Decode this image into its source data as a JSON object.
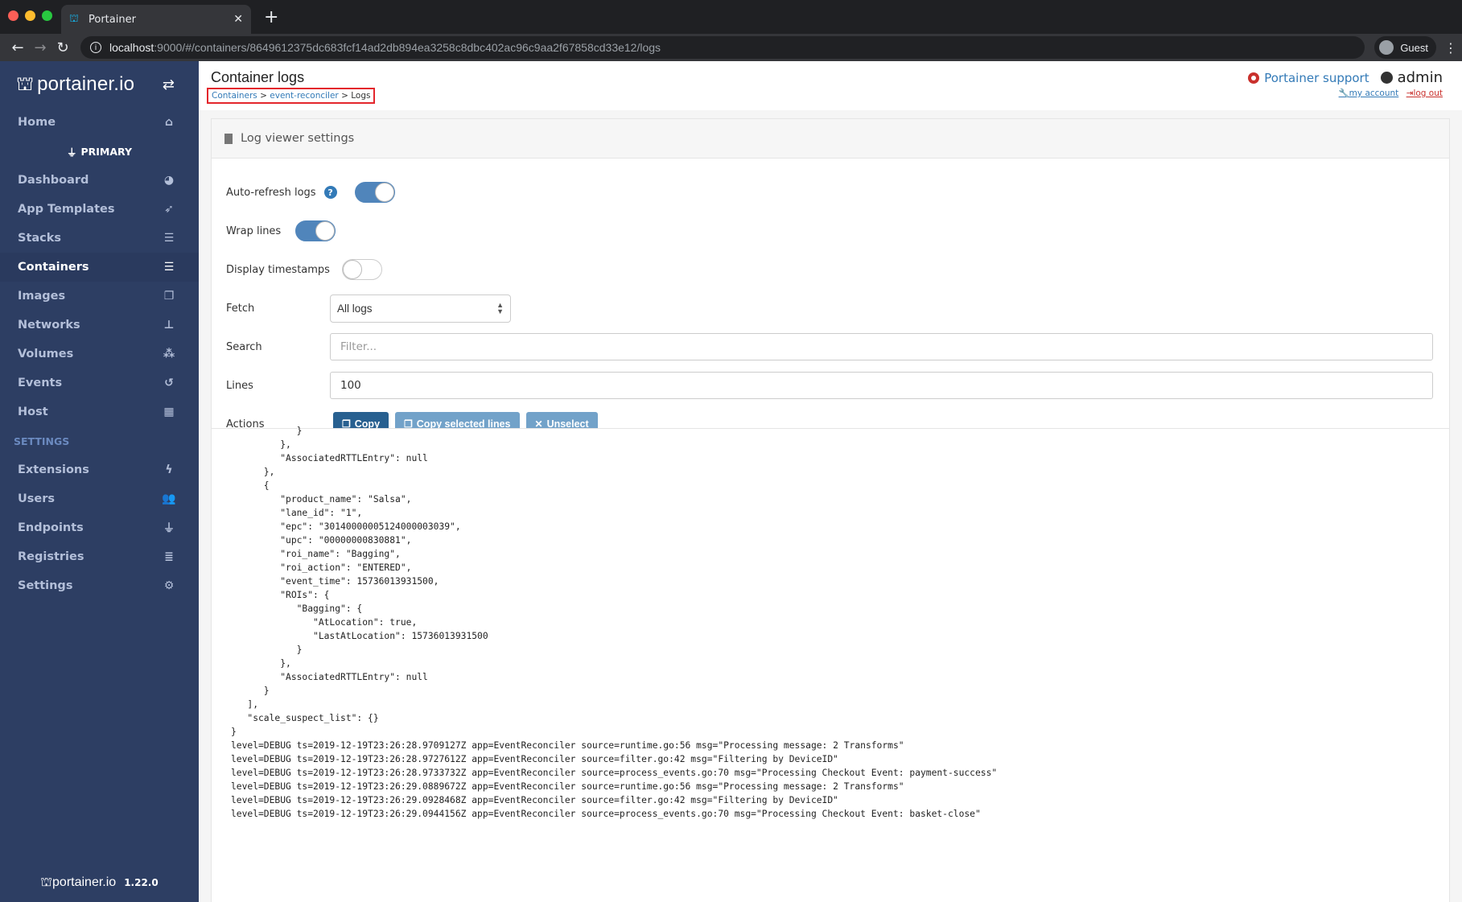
{
  "browser": {
    "tab_title": "Portainer",
    "url_host": "localhost",
    "url_rest": ":9000/#/containers/8649612375dc683fcf14ad2db894ea3258c8dbc402ac96c9aa2f67858cd33e12/logs",
    "profile_label": "Guest"
  },
  "sidebar": {
    "brand": "portainer.io",
    "home": "Home",
    "endpoint": "PRIMARY",
    "items": [
      {
        "label": "Dashboard",
        "icon": "tachometer-icon",
        "glyph": "◕"
      },
      {
        "label": "App Templates",
        "icon": "rocket-icon",
        "glyph": "➶"
      },
      {
        "label": "Stacks",
        "icon": "list-icon",
        "glyph": "☰"
      },
      {
        "label": "Containers",
        "icon": "server-icon",
        "glyph": "☰",
        "active": true
      },
      {
        "label": "Images",
        "icon": "clone-icon",
        "glyph": "❐"
      },
      {
        "label": "Networks",
        "icon": "sitemap-icon",
        "glyph": "⊥"
      },
      {
        "label": "Volumes",
        "icon": "cubes-icon",
        "glyph": "⁂"
      },
      {
        "label": "Events",
        "icon": "history-icon",
        "glyph": "↺"
      },
      {
        "label": "Host",
        "icon": "th-icon",
        "glyph": "▦"
      }
    ],
    "settings_section": "SETTINGS",
    "settings_items": [
      {
        "label": "Extensions",
        "icon": "bolt-icon",
        "glyph": "ϟ"
      },
      {
        "label": "Users",
        "icon": "users-icon",
        "glyph": "👥"
      },
      {
        "label": "Endpoints",
        "icon": "plug-icon",
        "glyph": "⏚"
      },
      {
        "label": "Registries",
        "icon": "database-icon",
        "glyph": "≣"
      },
      {
        "label": "Settings",
        "icon": "cogs-icon",
        "glyph": "⚙"
      }
    ],
    "footer_brand": "portainer.io",
    "version": "1.22.0"
  },
  "header": {
    "title": "Container logs",
    "breadcrumb": [
      {
        "label": "Containers"
      },
      {
        "label": "event-reconciler"
      },
      {
        "label": "Logs"
      }
    ],
    "support": "Portainer support",
    "user": "admin",
    "my_account": "my account",
    "log_out": "log out"
  },
  "settings_panel": {
    "title": "Log viewer settings",
    "auto_refresh_label": "Auto-refresh logs",
    "auto_refresh": true,
    "wrap_lines_label": "Wrap lines",
    "wrap_lines": true,
    "timestamps_label": "Display timestamps",
    "timestamps": false,
    "fetch_label": "Fetch",
    "fetch_value": "All logs",
    "search_label": "Search",
    "search_placeholder": "Filter...",
    "search_value": "",
    "lines_label": "Lines",
    "lines_value": "100",
    "actions_label": "Actions",
    "copy": "Copy",
    "copy_selected": "Copy selected lines",
    "unselect": "Unselect"
  },
  "logs": [
    "            }",
    "         },",
    "         \"AssociatedRTTLEntry\": null",
    "      },",
    "      {",
    "         \"product_name\": \"Salsa\",",
    "         \"lane_id\": \"1\",",
    "         \"epc\": \"30140000005124000003039\",",
    "         \"upc\": \"00000000830881\",",
    "         \"roi_name\": \"Bagging\",",
    "         \"roi_action\": \"ENTERED\",",
    "         \"event_time\": 15736013931500,",
    "         \"ROIs\": {",
    "            \"Bagging\": {",
    "               \"AtLocation\": true,",
    "               \"LastAtLocation\": 15736013931500",
    "            }",
    "         },",
    "         \"AssociatedRTTLEntry\": null",
    "      }",
    "   ],",
    "   \"scale_suspect_list\": {}",
    "}",
    "level=DEBUG ts=2019-12-19T23:26:28.9709127Z app=EventReconciler source=runtime.go:56 msg=\"Processing message: 2 Transforms\"",
    "level=DEBUG ts=2019-12-19T23:26:28.9727612Z app=EventReconciler source=filter.go:42 msg=\"Filtering by DeviceID\"",
    "level=DEBUG ts=2019-12-19T23:26:28.9733732Z app=EventReconciler source=process_events.go:70 msg=\"Processing Checkout Event: payment-success\"",
    "level=DEBUG ts=2019-12-19T23:26:29.0889672Z app=EventReconciler source=runtime.go:56 msg=\"Processing message: 2 Transforms\"",
    "level=DEBUG ts=2019-12-19T23:26:29.0928468Z app=EventReconciler source=filter.go:42 msg=\"Filtering by DeviceID\"",
    "level=DEBUG ts=2019-12-19T23:26:29.0944156Z app=EventReconciler source=process_events.go:70 msg=\"Processing Checkout Event: basket-close\""
  ]
}
